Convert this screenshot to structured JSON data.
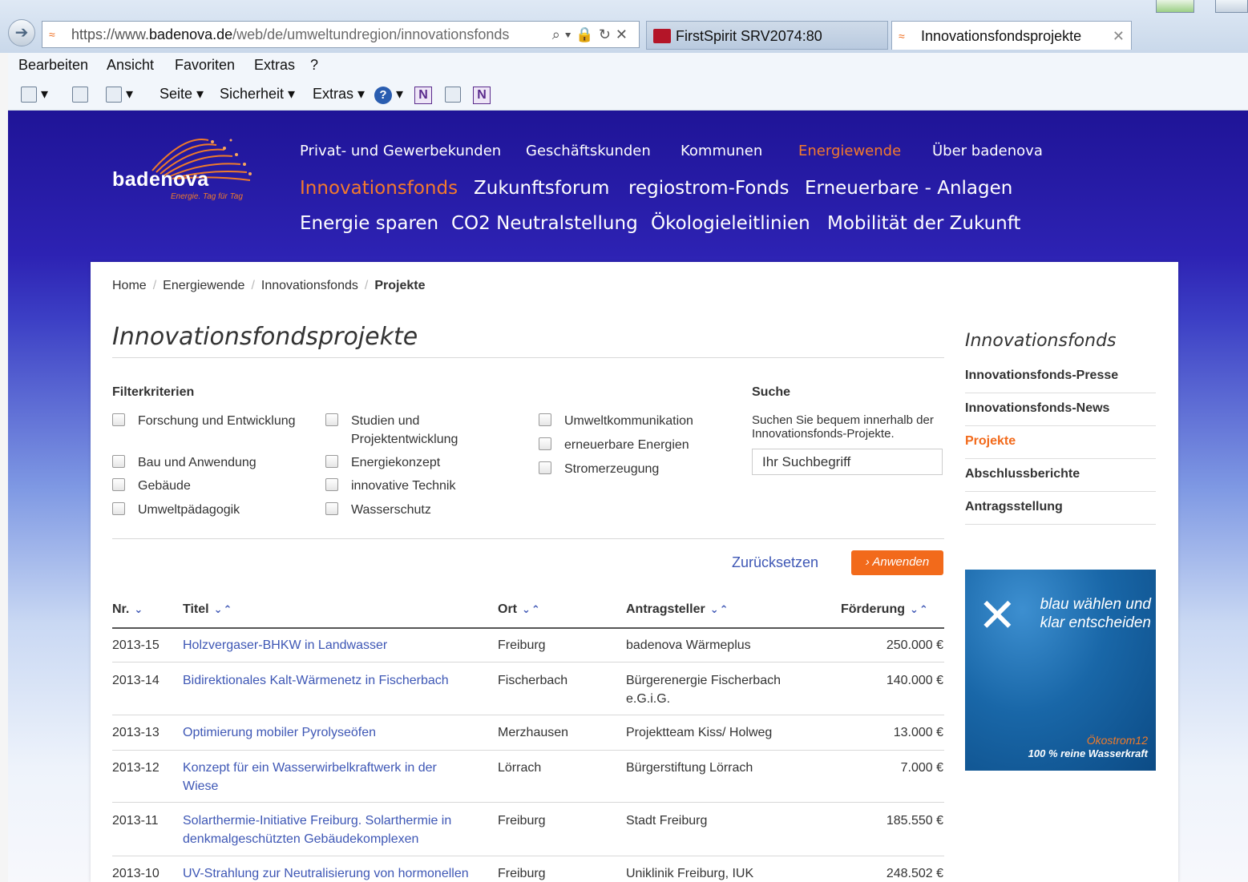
{
  "browser": {
    "url_prefix": "https://www.",
    "url_domain": "badenova.de",
    "url_path": "/web/de/umweltundregion/innovationsfonds",
    "tabs": [
      {
        "label": "FirstSpirit SRV2074:80"
      },
      {
        "label": "Innovationsfondsprojekte"
      }
    ],
    "menu": [
      "Bearbeiten",
      "Ansicht",
      "Favoriten",
      "Extras",
      "?"
    ],
    "toolbar": {
      "page": "Seite ▾",
      "security": "Sicherheit ▾",
      "extras": "Extras ▾"
    }
  },
  "site": {
    "logo_text": "badenova",
    "logo_slogan": "Energie. Tag für Tag",
    "nav_primary": [
      "Privat- und Gewerbekunden",
      "Geschäftskunden",
      "Kommunen",
      "Energiewende",
      "Über badenova"
    ],
    "nav_secondary_row1": [
      "Innovationsfonds",
      "Zukunftsforum",
      "regiostrom-Fonds",
      "Erneuerbare - Anlagen"
    ],
    "nav_secondary_row2": [
      "Energie sparen",
      "CO2 Neutralstellung",
      "Ökologieleitlinien",
      "Mobilität der Zukunft"
    ],
    "accent_color": "#f26a1b"
  },
  "breadcrumb": [
    "Home",
    "Energiewende",
    "Innovationsfonds",
    "Projekte"
  ],
  "page_title": "Innovationsfondsprojekte",
  "filter": {
    "heading": "Filterkriterien",
    "col1": [
      "Forschung und Entwicklung",
      "Bau und Anwendung",
      "Gebäude",
      "Umweltpädagogik"
    ],
    "col2": [
      "Studien und Projektentwicklung",
      "Energiekonzept",
      "innovative Technik",
      "Wasserschutz"
    ],
    "col3": [
      "Umweltkommunikation",
      "erneuerbare Energien",
      "Stromerzeugung"
    ]
  },
  "search": {
    "heading": "Suche",
    "description": "Suchen Sie bequem innerhalb der Innovationsfonds-Projekte.",
    "value": "Ihr Suchbegriff"
  },
  "actions": {
    "reset": "Zurücksetzen",
    "apply": "Anwenden"
  },
  "table": {
    "headers": {
      "nr": "Nr.",
      "title": "Titel",
      "place": "Ort",
      "applicant": "Antragsteller",
      "funding": "Förderung"
    },
    "rows": [
      {
        "nr": "2013-15",
        "title": "Holzvergaser-BHKW in Landwasser",
        "place": "Freiburg",
        "applicant": "badenova Wärmeplus",
        "funding": "250.000 €"
      },
      {
        "nr": "2013-14",
        "title": "Bidirektionales Kalt-Wärmenetz in Fischerbach",
        "place": "Fischerbach",
        "applicant": "Bürgerenergie Fischerbach e.G.i.G.",
        "funding": "140.000 €"
      },
      {
        "nr": "2013-13",
        "title": "Optimierung mobiler Pyrolyseöfen",
        "place": "Merzhausen",
        "applicant": "Projektteam Kiss/ Holweg",
        "funding": "13.000 €"
      },
      {
        "nr": "2013-12",
        "title": "Konzept für ein Wasserwirbelkraftwerk in der Wiese",
        "place": "Lörrach",
        "applicant": "Bürgerstiftung Lörrach",
        "funding": "7.000 €"
      },
      {
        "nr": "2013-11",
        "title": "Solarthermie-Initiative Freiburg. Solarthermie in denkmalgeschützten Gebäudekomplexen",
        "place": "Freiburg",
        "applicant": "Stadt Freiburg",
        "funding": "185.550 €"
      },
      {
        "nr": "2013-10",
        "title": "UV-Strahlung zur Neutralisierung von hormonellen",
        "place": "Freiburg",
        "applicant": "Uniklinik Freiburg, IUK",
        "funding": "248.502 €"
      }
    ]
  },
  "sidebar": {
    "title": "Innovationsfonds",
    "items": [
      "Innovationsfonds-Presse",
      "Innovationsfonds-News",
      "Projekte",
      "Abschlussberichte",
      "Antragsstellung"
    ]
  },
  "ad": {
    "headline": "blau wählen und klar entscheiden",
    "product": "Ökostrom12",
    "tagline": "100 % reine Wasserkraft"
  }
}
